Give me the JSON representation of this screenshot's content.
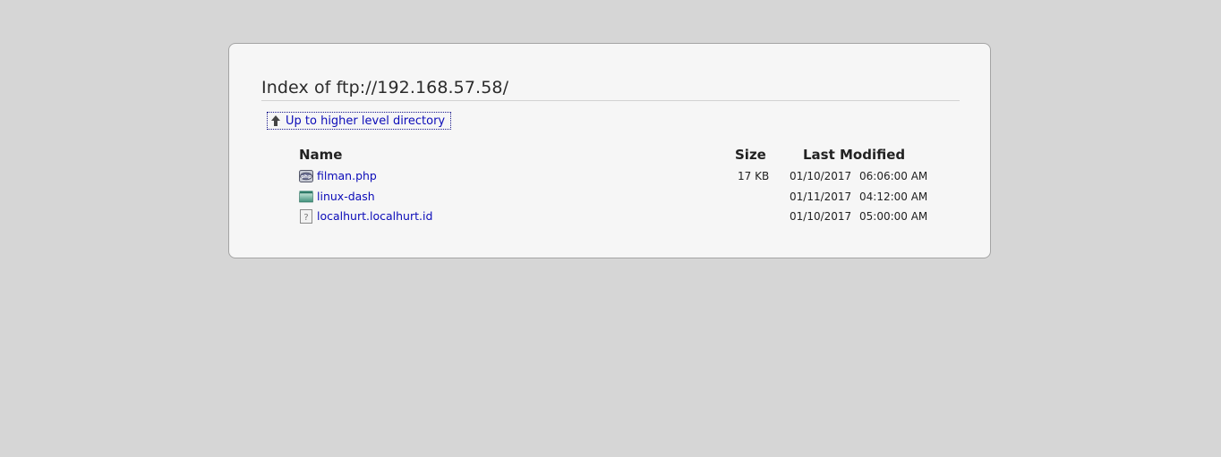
{
  "page": {
    "title": "Index of ftp://192.168.57.58/",
    "up_link_label": "Up to higher level directory"
  },
  "table": {
    "headers": {
      "name": "Name",
      "size": "Size",
      "modified": "Last Modified"
    },
    "rows": [
      {
        "icon": "php-file-icon",
        "name": "filman.php",
        "size": "17 KB",
        "date": "01/10/2017",
        "time": "06:06:00 AM"
      },
      {
        "icon": "folder-icon",
        "name": "linux-dash",
        "size": "",
        "date": "01/11/2017",
        "time": "04:12:00 AM"
      },
      {
        "icon": "unknown-file-icon",
        "name": "localhurt.localhurt.id",
        "size": "",
        "date": "01/10/2017",
        "time": "05:00:00 AM"
      }
    ]
  },
  "colors": {
    "page_background": "#d6d6d6",
    "panel_background": "#f6f6f6",
    "link": "#0b0bb8"
  }
}
